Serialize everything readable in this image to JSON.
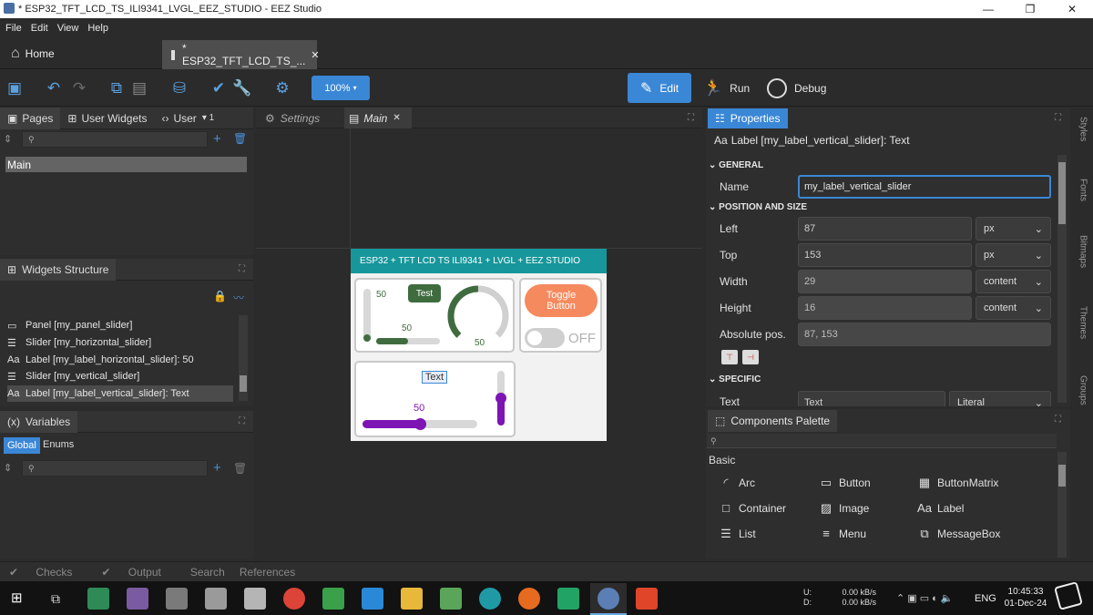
{
  "window": {
    "title": "* ESP32_TFT_LCD_TS_ILI9341_LVGL_EEZ_STUDIO - EEZ Studio",
    "minimize": "—",
    "maximize": "❐",
    "close": "✕"
  },
  "menu": [
    "File",
    "Edit",
    "View",
    "Help"
  ],
  "tabs": {
    "home": "Home",
    "doc": "* ESP32_TFT_LCD_TS_...",
    "close": "✕"
  },
  "toolbar": {
    "zoom": "100%",
    "edit": "Edit",
    "run": "Run",
    "debug": "Debug"
  },
  "left_panel": {
    "tabs": [
      "Pages",
      "User Widgets",
      "User"
    ],
    "user_extra": "▾ 1",
    "pages": [
      "Main"
    ],
    "widgets_title": "Widgets Structure",
    "widgets": [
      "Panel [my_panel_slider]",
      "Slider [my_horizontal_slider]",
      "Label [my_label_horizontal_slider]: 50",
      "Slider [my_vertical_slider]",
      "Label [my_label_vertical_slider]: Text"
    ],
    "variables_title": "Variables",
    "var_tabs": [
      "Global",
      "Enums"
    ]
  },
  "editor": {
    "tabs": [
      "Settings",
      "Main"
    ],
    "close": "✕"
  },
  "device": {
    "header": "ESP32 + TFT LCD TS  ILI9341 + LVGL + EEZ STUDIO",
    "vslider_value": "50",
    "btn_test": "Test",
    "hslider_value": "50",
    "arc_value": "50",
    "toggle_button": "Toggle Button",
    "switch_label": "OFF",
    "text_label": "Text",
    "purple_value": "50",
    "vslider_level": 0.0,
    "hslider_level": 0.5,
    "arc_level": 0.5,
    "purple_level": 0.5,
    "purple_vlevel": 0.5
  },
  "properties": {
    "title": "Properties",
    "subtitle": "Label [my_label_vertical_slider]: Text",
    "general": "GENERAL",
    "name_label": "Name",
    "name_value": "my_label_vertical_slider",
    "position_size": "POSITION AND SIZE",
    "rows": [
      {
        "label": "Left",
        "value": "87",
        "unit": "px"
      },
      {
        "label": "Top",
        "value": "153",
        "unit": "px"
      },
      {
        "label": "Width",
        "value": "29",
        "unit": "content"
      },
      {
        "label": "Height",
        "value": "16",
        "unit": "content"
      }
    ],
    "abs_label": "Absolute pos.",
    "abs_value": "87, 153",
    "specific": "SPECIFIC",
    "text_label": "Text",
    "text_value": "Text",
    "text_mode": "Literal"
  },
  "palette": {
    "title": "Components Palette",
    "group": "Basic",
    "items": [
      "Arc",
      "Button",
      "ButtonMatrix",
      "Container",
      "Image",
      "Label",
      "List",
      "Menu",
      "MessageBox"
    ]
  },
  "side_tabs": [
    "Styles",
    "Fonts",
    "Bitmaps",
    "Themes",
    "Groups"
  ],
  "status": [
    "Checks",
    "Output",
    "Search",
    "References"
  ],
  "taskbar": {
    "net_u": "U:",
    "net_d": "D:",
    "up": "0.00 kB/s",
    "down": "0.00 kB/s",
    "lang": "ENG",
    "time": "10:45:33",
    "date": "01-Dec-24"
  },
  "colors": {
    "accent": "#3a87d6",
    "teal": "#17979b",
    "green": "#3f6c3f",
    "orange": "#f58a5e",
    "purple": "#7d14b4"
  }
}
